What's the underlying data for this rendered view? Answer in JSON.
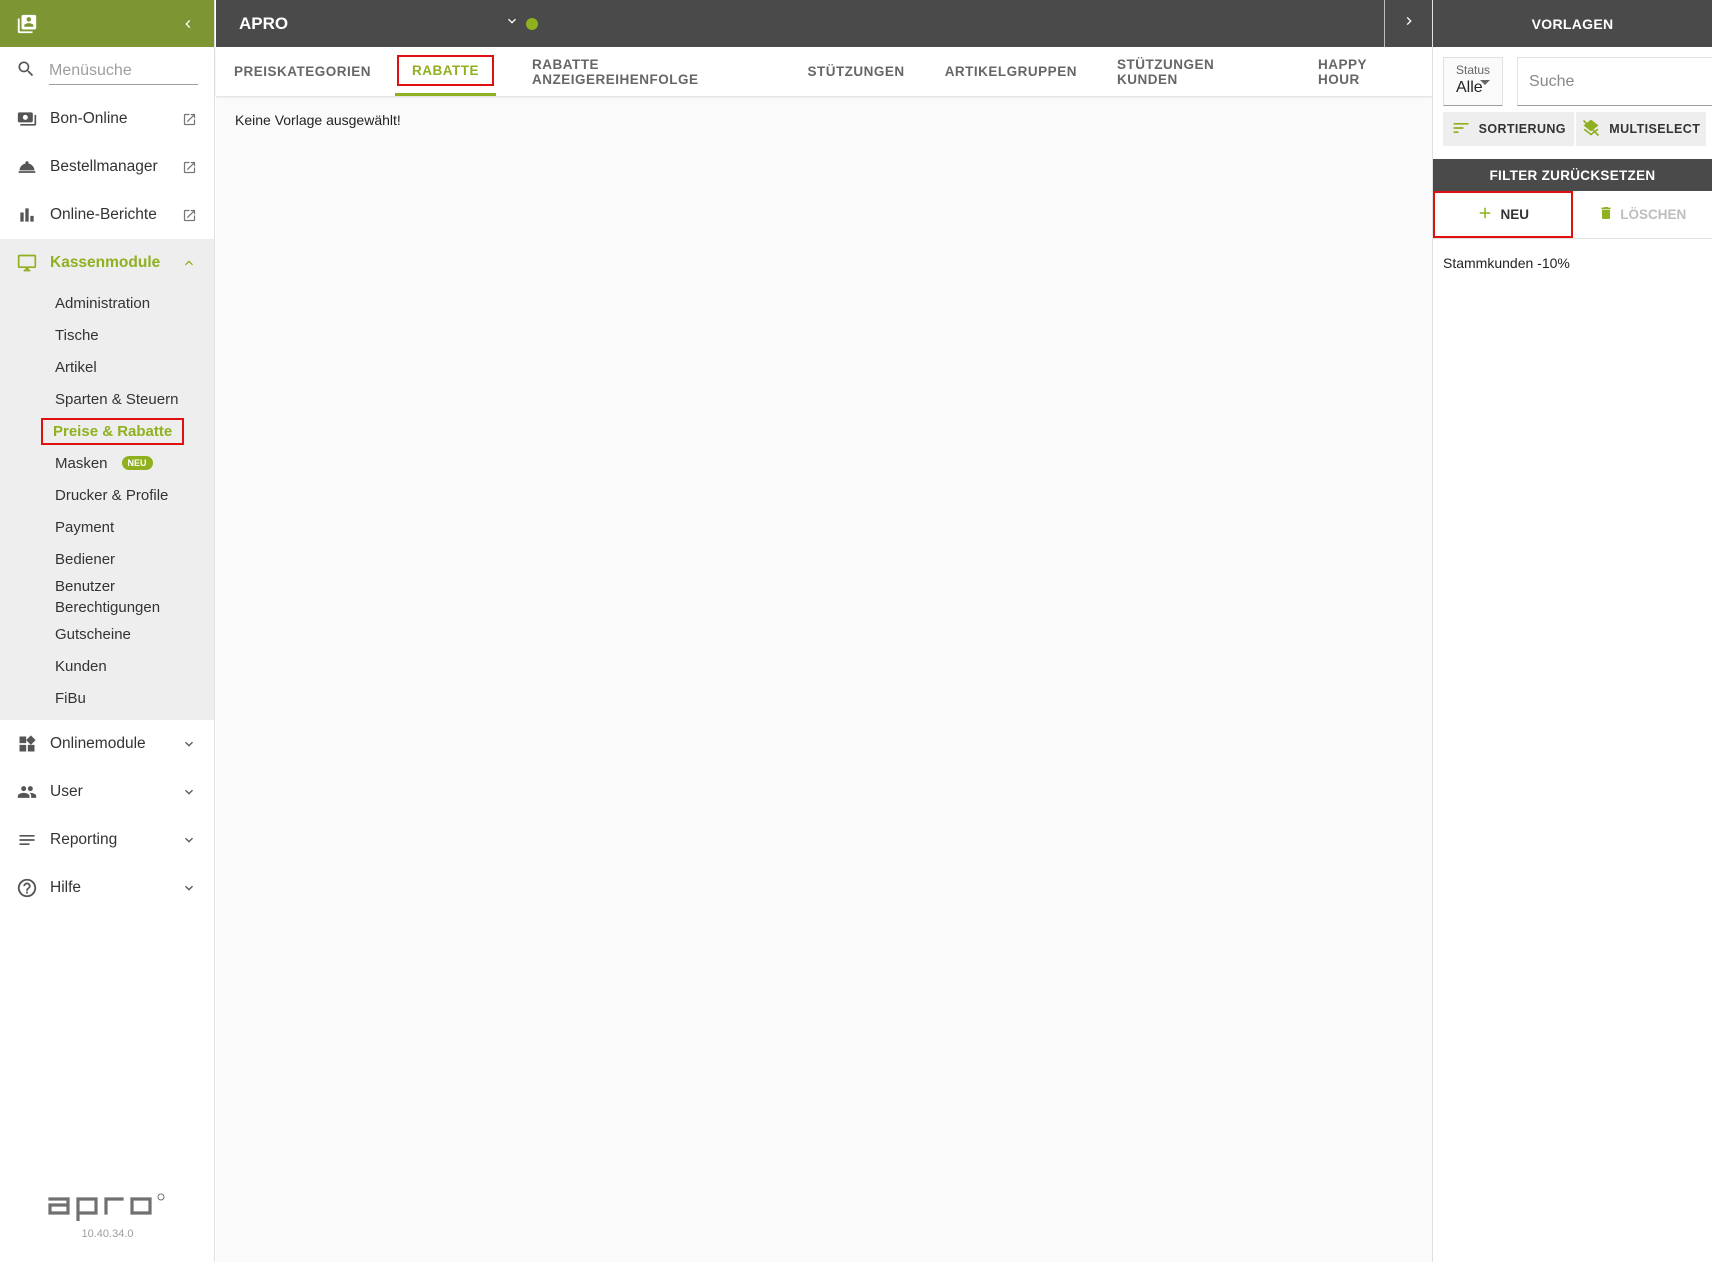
{
  "sidebar": {
    "search_placeholder": "Menüsuche",
    "items": [
      {
        "label": "Bon-Online"
      },
      {
        "label": "Bestellmanager"
      },
      {
        "label": "Online-Berichte"
      },
      {
        "label": "Kassenmodule"
      },
      {
        "label": "Onlinemodule"
      },
      {
        "label": "User"
      },
      {
        "label": "Reporting"
      },
      {
        "label": "Hilfe"
      }
    ],
    "sub_items": [
      {
        "label": "Administration"
      },
      {
        "label": "Tische"
      },
      {
        "label": "Artikel"
      },
      {
        "label": "Sparten & Steuern"
      },
      {
        "label": "Preise & Rabatte"
      },
      {
        "label": "Masken",
        "badge": "NEU"
      },
      {
        "label": "Drucker & Profile"
      },
      {
        "label": "Payment"
      },
      {
        "label": "Bediener"
      },
      {
        "label": "Benutzer Berechtigungen"
      },
      {
        "label": "Gutscheine"
      },
      {
        "label": "Kunden"
      },
      {
        "label": "FiBu"
      }
    ],
    "version": "10.40.34.0"
  },
  "topbar": {
    "title": "APRO"
  },
  "tabs": [
    {
      "label": "PREISKATEGORIEN"
    },
    {
      "label": "RABATTE"
    },
    {
      "label": "RABATTE ANZEIGEREIHENFOLGE"
    },
    {
      "label": "STÜTZUNGEN"
    },
    {
      "label": "ARTIKELGRUPPEN"
    },
    {
      "label": "STÜTZUNGEN KUNDEN"
    },
    {
      "label": "HAPPY HOUR"
    }
  ],
  "main": {
    "empty_message": "Keine Vorlage ausgewählt!"
  },
  "right_panel": {
    "title": "VORLAGEN",
    "status_label": "Status",
    "status_value": "Alle",
    "search_placeholder": "Suche",
    "sort_label": "SORTIERUNG",
    "multiselect_label": "MULTISELECT",
    "reset_label": "FILTER ZURÜCKSETZEN",
    "new_label": "NEU",
    "delete_label": "LÖSCHEN",
    "list": [
      {
        "label": "Stammkunden -10%"
      }
    ]
  },
  "colors": {
    "accent": "#8fb01f",
    "header_dark": "#4a4a4a",
    "header_green": "#7d9633",
    "highlight": "#e01010"
  }
}
